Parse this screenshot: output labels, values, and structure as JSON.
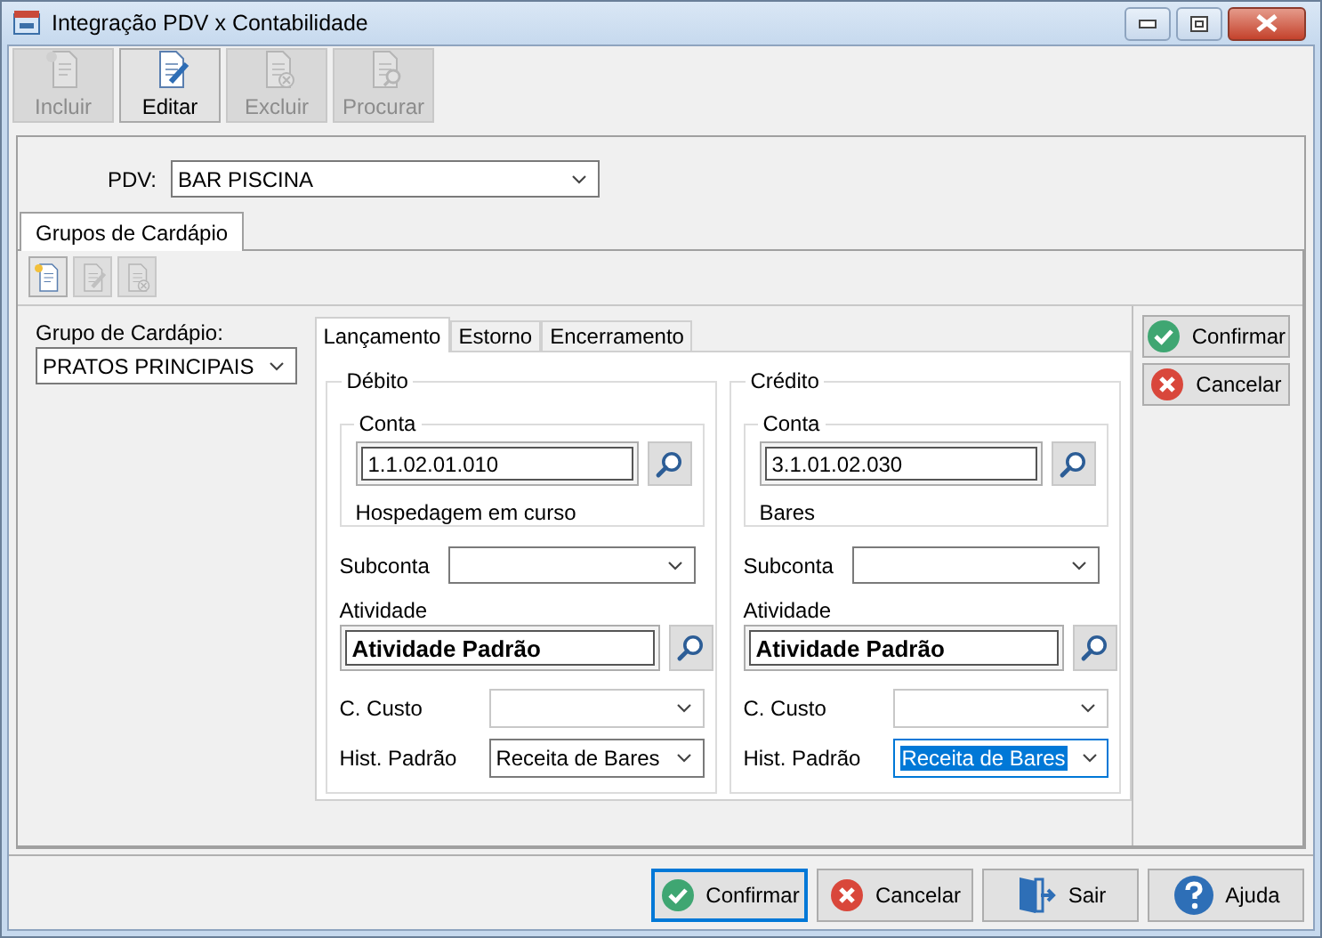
{
  "window": {
    "title": "Integração PDV x Contabilidade"
  },
  "toolbar": [
    {
      "label": "Incluir",
      "kind": "new",
      "disabled": true
    },
    {
      "label": "Editar",
      "kind": "edit",
      "disabled": false
    },
    {
      "label": "Excluir",
      "kind": "delete",
      "disabled": true
    },
    {
      "label": "Procurar",
      "kind": "find",
      "disabled": true
    }
  ],
  "pdv": {
    "label": "PDV:",
    "value": "BAR PISCINA"
  },
  "outer_tabs": [
    {
      "label": "Grupos de Cardápio",
      "selected": true
    }
  ],
  "mini_toolbar": [
    {
      "kind": "new",
      "disabled": false
    },
    {
      "kind": "edit",
      "disabled": true
    },
    {
      "kind": "delete",
      "disabled": true
    }
  ],
  "grupo": {
    "label": "Grupo de Cardápio:",
    "value": "PRATOS PRINCIPAIS"
  },
  "inner_tabs": [
    {
      "label": "Lançamento",
      "selected": true
    },
    {
      "label": "Estorno",
      "selected": false
    },
    {
      "label": "Encerramento",
      "selected": false
    }
  ],
  "sections": [
    {
      "title": "Débito",
      "conta_label": "Conta",
      "conta": "1.1.02.01.010",
      "conta_desc": "Hospedagem em curso",
      "subconta_label": "Subconta",
      "atividade_label": "Atividade",
      "atividade": "Atividade Padrão",
      "custo_label": "C. Custo",
      "hist_label": "Hist. Padrão",
      "hist": "Receita de Bares",
      "hist_focused": false
    },
    {
      "title": "Crédito",
      "conta_label": "Conta",
      "conta": "3.1.01.02.030",
      "conta_desc": "Bares",
      "subconta_label": "Subconta",
      "atividade_label": "Atividade",
      "atividade": "Atividade Padrão",
      "custo_label": "C. Custo",
      "hist_label": "Hist. Padrão",
      "hist": "Receita de Bares",
      "hist_focused": true
    }
  ],
  "side_buttons": [
    {
      "label": "Confirmar",
      "kind": "confirm"
    },
    {
      "label": "Cancelar",
      "kind": "cancel"
    }
  ],
  "footer_buttons": [
    {
      "label": "Confirmar",
      "kind": "confirm",
      "focused": true
    },
    {
      "label": "Cancelar",
      "kind": "cancel",
      "focused": false
    },
    {
      "label": "Sair",
      "kind": "exit",
      "focused": false
    },
    {
      "label": "Ajuda",
      "kind": "help",
      "focused": false
    }
  ]
}
